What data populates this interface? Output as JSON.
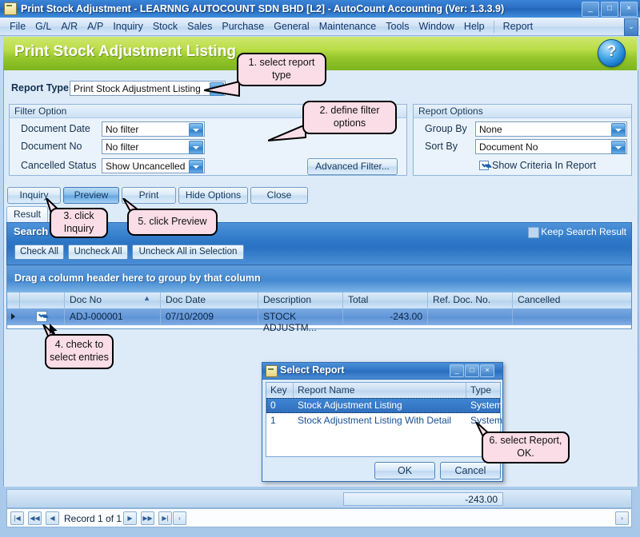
{
  "window": {
    "title": "Print Stock Adjustment - LEARNNG AUTOCOUNT SDN BHD [L2] - AutoCount Accounting (Ver: 1.3.3.9)",
    "minimize": "_",
    "maximize": "□",
    "close": "×"
  },
  "menubar": {
    "items": [
      "File",
      "G/L",
      "A/R",
      "A/P",
      "Inquiry",
      "Stock",
      "Sales",
      "Purchase",
      "General",
      "Maintenance",
      "Tools",
      "Window",
      "Help"
    ],
    "extra": "Report",
    "chevron": "⌄"
  },
  "page": {
    "title": "Print Stock Adjustment Listing",
    "help_glyph": "?"
  },
  "report_type": {
    "label": "Report Type",
    "value": "Print Stock Adjustment Listing"
  },
  "filter_option": {
    "title": "Filter Option",
    "rows": [
      {
        "label": "Document Date",
        "value": "No filter"
      },
      {
        "label": "Document No",
        "value": "No filter"
      },
      {
        "label": "Cancelled Status",
        "value": "Show Uncancelled"
      }
    ],
    "advanced_button": "Advanced Filter..."
  },
  "report_options": {
    "title": "Report Options",
    "rows": [
      {
        "label": "Group By",
        "value": "None"
      },
      {
        "label": "Sort By",
        "value": "Document No"
      }
    ],
    "checkbox_label": "Show Criteria In Report",
    "checkbox_checked": true
  },
  "toolbar": {
    "buttons": [
      "Inquiry",
      "Preview",
      "Print",
      "Hide Options",
      "Close"
    ],
    "active": "Preview"
  },
  "tab": {
    "label": "Result"
  },
  "search_result": {
    "title": "Search Result",
    "keep_label": "Keep Search Result",
    "keep_checked": false,
    "buttons": [
      "Check All",
      "Uncheck All",
      "Uncheck All in Selection"
    ]
  },
  "grid": {
    "group_hint": "Drag a column header here to group by that column",
    "sort_indicator": "▲",
    "columns": [
      "Doc No",
      "Doc Date",
      "Description",
      "Total",
      "Ref. Doc. No.",
      "Cancelled"
    ],
    "rows": [
      {
        "checked": true,
        "doc_no": "ADJ-000001",
        "doc_date": "07/10/2009",
        "description": "STOCK ADJUSTM...",
        "total": "-243.00",
        "ref_doc_no": "",
        "cancelled": ""
      }
    ]
  },
  "select_report_dialog": {
    "title": "Select Report",
    "minimize": "_",
    "maximize": "□",
    "close": "×",
    "columns": [
      "Key",
      "Report Name",
      "Type"
    ],
    "rows": [
      {
        "key": "0",
        "name": "Stock Adjustment Listing",
        "type": "System",
        "selected": true
      },
      {
        "key": "1",
        "name": "Stock Adjustment Listing With Detail",
        "type": "System",
        "selected": false
      }
    ],
    "ok": "OK",
    "cancel": "Cancel"
  },
  "footer": {
    "total": "-243.00",
    "record_text": "Record 1 of 1",
    "nav_first": "|◀",
    "nav_prevpage": "◀◀",
    "nav_prev": "◀",
    "nav_next": "▶",
    "nav_nextpage": "▶▶",
    "nav_last": "▶|",
    "nav_extra": "‹",
    "nav_right": "›"
  },
  "callouts": [
    {
      "id": "c1",
      "text": "1. select report type"
    },
    {
      "id": "c2",
      "text": "2. define filter options"
    },
    {
      "id": "c3",
      "text": "3. click Inquiry"
    },
    {
      "id": "c4",
      "text": "4. check to select entries"
    },
    {
      "id": "c5",
      "text": "5. click Preview"
    },
    {
      "id": "c6",
      "text": "6. select Report, OK."
    }
  ],
  "colors": {
    "title_blue": "#2c6fc4",
    "header_green": "#96c72c",
    "panel_blue": "#ddebf9",
    "callout_pink": "#fadde7",
    "grid_row_blue": "#6197d8"
  }
}
